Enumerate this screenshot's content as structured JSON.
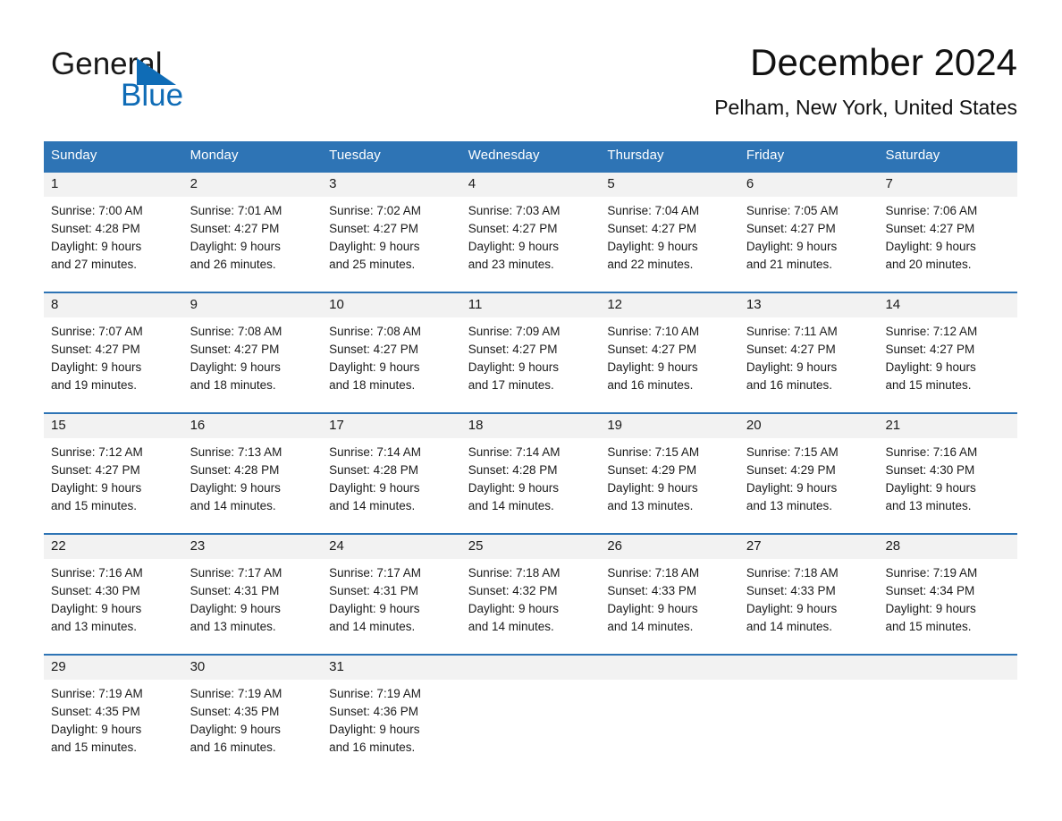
{
  "brand": {
    "name_part1": "General",
    "name_part2": "Blue",
    "logo_icon": "triangle-icon",
    "accent_color": "#0f6cb6"
  },
  "header": {
    "month_title": "December 2024",
    "location": "Pelham, New York, United States"
  },
  "theme": {
    "header_blue": "#2e74b5",
    "date_band_gray": "#f2f2f2",
    "text_dark": "#1a1a1a"
  },
  "calendar": {
    "weekdays": [
      "Sunday",
      "Monday",
      "Tuesday",
      "Wednesday",
      "Thursday",
      "Friday",
      "Saturday"
    ],
    "weeks": [
      [
        {
          "day": "1",
          "sunrise": "Sunrise: 7:00 AM",
          "sunset": "Sunset: 4:28 PM",
          "daylight_line1": "Daylight: 9 hours",
          "daylight_line2": "and 27 minutes."
        },
        {
          "day": "2",
          "sunrise": "Sunrise: 7:01 AM",
          "sunset": "Sunset: 4:27 PM",
          "daylight_line1": "Daylight: 9 hours",
          "daylight_line2": "and 26 minutes."
        },
        {
          "day": "3",
          "sunrise": "Sunrise: 7:02 AM",
          "sunset": "Sunset: 4:27 PM",
          "daylight_line1": "Daylight: 9 hours",
          "daylight_line2": "and 25 minutes."
        },
        {
          "day": "4",
          "sunrise": "Sunrise: 7:03 AM",
          "sunset": "Sunset: 4:27 PM",
          "daylight_line1": "Daylight: 9 hours",
          "daylight_line2": "and 23 minutes."
        },
        {
          "day": "5",
          "sunrise": "Sunrise: 7:04 AM",
          "sunset": "Sunset: 4:27 PM",
          "daylight_line1": "Daylight: 9 hours",
          "daylight_line2": "and 22 minutes."
        },
        {
          "day": "6",
          "sunrise": "Sunrise: 7:05 AM",
          "sunset": "Sunset: 4:27 PM",
          "daylight_line1": "Daylight: 9 hours",
          "daylight_line2": "and 21 minutes."
        },
        {
          "day": "7",
          "sunrise": "Sunrise: 7:06 AM",
          "sunset": "Sunset: 4:27 PM",
          "daylight_line1": "Daylight: 9 hours",
          "daylight_line2": "and 20 minutes."
        }
      ],
      [
        {
          "day": "8",
          "sunrise": "Sunrise: 7:07 AM",
          "sunset": "Sunset: 4:27 PM",
          "daylight_line1": "Daylight: 9 hours",
          "daylight_line2": "and 19 minutes."
        },
        {
          "day": "9",
          "sunrise": "Sunrise: 7:08 AM",
          "sunset": "Sunset: 4:27 PM",
          "daylight_line1": "Daylight: 9 hours",
          "daylight_line2": "and 18 minutes."
        },
        {
          "day": "10",
          "sunrise": "Sunrise: 7:08 AM",
          "sunset": "Sunset: 4:27 PM",
          "daylight_line1": "Daylight: 9 hours",
          "daylight_line2": "and 18 minutes."
        },
        {
          "day": "11",
          "sunrise": "Sunrise: 7:09 AM",
          "sunset": "Sunset: 4:27 PM",
          "daylight_line1": "Daylight: 9 hours",
          "daylight_line2": "and 17 minutes."
        },
        {
          "day": "12",
          "sunrise": "Sunrise: 7:10 AM",
          "sunset": "Sunset: 4:27 PM",
          "daylight_line1": "Daylight: 9 hours",
          "daylight_line2": "and 16 minutes."
        },
        {
          "day": "13",
          "sunrise": "Sunrise: 7:11 AM",
          "sunset": "Sunset: 4:27 PM",
          "daylight_line1": "Daylight: 9 hours",
          "daylight_line2": "and 16 minutes."
        },
        {
          "day": "14",
          "sunrise": "Sunrise: 7:12 AM",
          "sunset": "Sunset: 4:27 PM",
          "daylight_line1": "Daylight: 9 hours",
          "daylight_line2": "and 15 minutes."
        }
      ],
      [
        {
          "day": "15",
          "sunrise": "Sunrise: 7:12 AM",
          "sunset": "Sunset: 4:27 PM",
          "daylight_line1": "Daylight: 9 hours",
          "daylight_line2": "and 15 minutes."
        },
        {
          "day": "16",
          "sunrise": "Sunrise: 7:13 AM",
          "sunset": "Sunset: 4:28 PM",
          "daylight_line1": "Daylight: 9 hours",
          "daylight_line2": "and 14 minutes."
        },
        {
          "day": "17",
          "sunrise": "Sunrise: 7:14 AM",
          "sunset": "Sunset: 4:28 PM",
          "daylight_line1": "Daylight: 9 hours",
          "daylight_line2": "and 14 minutes."
        },
        {
          "day": "18",
          "sunrise": "Sunrise: 7:14 AM",
          "sunset": "Sunset: 4:28 PM",
          "daylight_line1": "Daylight: 9 hours",
          "daylight_line2": "and 14 minutes."
        },
        {
          "day": "19",
          "sunrise": "Sunrise: 7:15 AM",
          "sunset": "Sunset: 4:29 PM",
          "daylight_line1": "Daylight: 9 hours",
          "daylight_line2": "and 13 minutes."
        },
        {
          "day": "20",
          "sunrise": "Sunrise: 7:15 AM",
          "sunset": "Sunset: 4:29 PM",
          "daylight_line1": "Daylight: 9 hours",
          "daylight_line2": "and 13 minutes."
        },
        {
          "day": "21",
          "sunrise": "Sunrise: 7:16 AM",
          "sunset": "Sunset: 4:30 PM",
          "daylight_line1": "Daylight: 9 hours",
          "daylight_line2": "and 13 minutes."
        }
      ],
      [
        {
          "day": "22",
          "sunrise": "Sunrise: 7:16 AM",
          "sunset": "Sunset: 4:30 PM",
          "daylight_line1": "Daylight: 9 hours",
          "daylight_line2": "and 13 minutes."
        },
        {
          "day": "23",
          "sunrise": "Sunrise: 7:17 AM",
          "sunset": "Sunset: 4:31 PM",
          "daylight_line1": "Daylight: 9 hours",
          "daylight_line2": "and 13 minutes."
        },
        {
          "day": "24",
          "sunrise": "Sunrise: 7:17 AM",
          "sunset": "Sunset: 4:31 PM",
          "daylight_line1": "Daylight: 9 hours",
          "daylight_line2": "and 14 minutes."
        },
        {
          "day": "25",
          "sunrise": "Sunrise: 7:18 AM",
          "sunset": "Sunset: 4:32 PM",
          "daylight_line1": "Daylight: 9 hours",
          "daylight_line2": "and 14 minutes."
        },
        {
          "day": "26",
          "sunrise": "Sunrise: 7:18 AM",
          "sunset": "Sunset: 4:33 PM",
          "daylight_line1": "Daylight: 9 hours",
          "daylight_line2": "and 14 minutes."
        },
        {
          "day": "27",
          "sunrise": "Sunrise: 7:18 AM",
          "sunset": "Sunset: 4:33 PM",
          "daylight_line1": "Daylight: 9 hours",
          "daylight_line2": "and 14 minutes."
        },
        {
          "day": "28",
          "sunrise": "Sunrise: 7:19 AM",
          "sunset": "Sunset: 4:34 PM",
          "daylight_line1": "Daylight: 9 hours",
          "daylight_line2": "and 15 minutes."
        }
      ],
      [
        {
          "day": "29",
          "sunrise": "Sunrise: 7:19 AM",
          "sunset": "Sunset: 4:35 PM",
          "daylight_line1": "Daylight: 9 hours",
          "daylight_line2": "and 15 minutes."
        },
        {
          "day": "30",
          "sunrise": "Sunrise: 7:19 AM",
          "sunset": "Sunset: 4:35 PM",
          "daylight_line1": "Daylight: 9 hours",
          "daylight_line2": "and 16 minutes."
        },
        {
          "day": "31",
          "sunrise": "Sunrise: 7:19 AM",
          "sunset": "Sunset: 4:36 PM",
          "daylight_line1": "Daylight: 9 hours",
          "daylight_line2": "and 16 minutes."
        },
        {
          "day": "",
          "sunrise": "",
          "sunset": "",
          "daylight_line1": "",
          "daylight_line2": ""
        },
        {
          "day": "",
          "sunrise": "",
          "sunset": "",
          "daylight_line1": "",
          "daylight_line2": ""
        },
        {
          "day": "",
          "sunrise": "",
          "sunset": "",
          "daylight_line1": "",
          "daylight_line2": ""
        },
        {
          "day": "",
          "sunrise": "",
          "sunset": "",
          "daylight_line1": "",
          "daylight_line2": ""
        }
      ]
    ]
  }
}
